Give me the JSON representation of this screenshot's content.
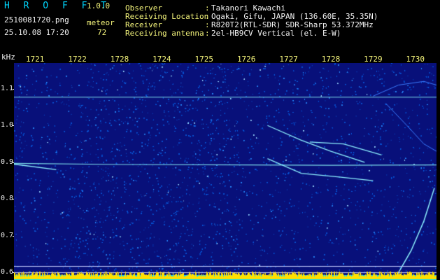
{
  "header": {
    "logo": "H R O F F T",
    "version": "1.0.0",
    "filename": "2510081720.png",
    "datetime": "25.10.08 17:20",
    "count_label": "meteor",
    "count_value": "72"
  },
  "info": [
    {
      "key": "Observer",
      "sep": ":",
      "value": "Takanori Kawachi"
    },
    {
      "key": "Receiving Location",
      "sep": ":",
      "value": "Ogaki, Gifu, JAPAN (136.60E, 35.35N)"
    },
    {
      "key": "Receiver",
      "sep": ":",
      "value": "R820T2(RTL-SDR) SDR-Sharp 53.372MHz"
    },
    {
      "key": "Receiving antenna",
      "sep": ":",
      "value": "2el-HB9CV Vertical (el. E-W)"
    }
  ],
  "spectrogram": {
    "y_unit": "kHz",
    "y_ticks": [
      "1.1",
      "1.0",
      "0.9",
      "0.8",
      "0.7",
      "0.6"
    ],
    "y_values": [
      1.1,
      1.0,
      0.9,
      0.8,
      0.7,
      0.6
    ],
    "y_range": [
      0.58,
      1.17
    ],
    "x_ticks": [
      "1721",
      "1722",
      "1728",
      "1724",
      "1725",
      "1726",
      "1727",
      "1728",
      "1729",
      "1730"
    ],
    "x_minutes": [
      1,
      2,
      3,
      4,
      5,
      6,
      7,
      8,
      9,
      10
    ],
    "x_range": [
      0.5,
      10.5
    ],
    "colors": {
      "background": "#08107a",
      "noise": "#0a58d8",
      "echo": "#8ef2ff",
      "carrier": "#7ad8e8",
      "baseline_bars": "#ffe000",
      "baseline_fill": "#00d8ff"
    }
  }
}
